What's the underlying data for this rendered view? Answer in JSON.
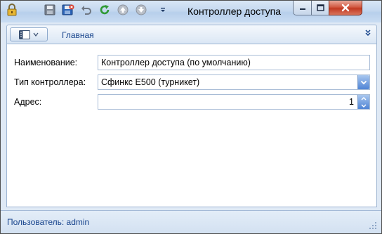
{
  "window": {
    "title": "Контроллер доступа ..."
  },
  "toolbar": {
    "icons": [
      "lock-icon",
      "save-icon",
      "save-close-icon",
      "undo-icon",
      "refresh-icon",
      "up-icon",
      "down-icon",
      "dropdown-icon"
    ]
  },
  "ribbon": {
    "tab_main": "Главная"
  },
  "form": {
    "name_label": "Наименование:",
    "name_value": "Контроллер доступа (по умолчанию)",
    "type_label": "Тип контроллера:",
    "type_value": "Сфинкс E500 (турникет)",
    "address_label": "Адрес:",
    "address_value": "1"
  },
  "status": {
    "user_text": "Пользователь: admin"
  },
  "colors": {
    "accent_text": "#15428b",
    "panel_bg": "#dfe9f5",
    "close_red": "#c23a22"
  }
}
